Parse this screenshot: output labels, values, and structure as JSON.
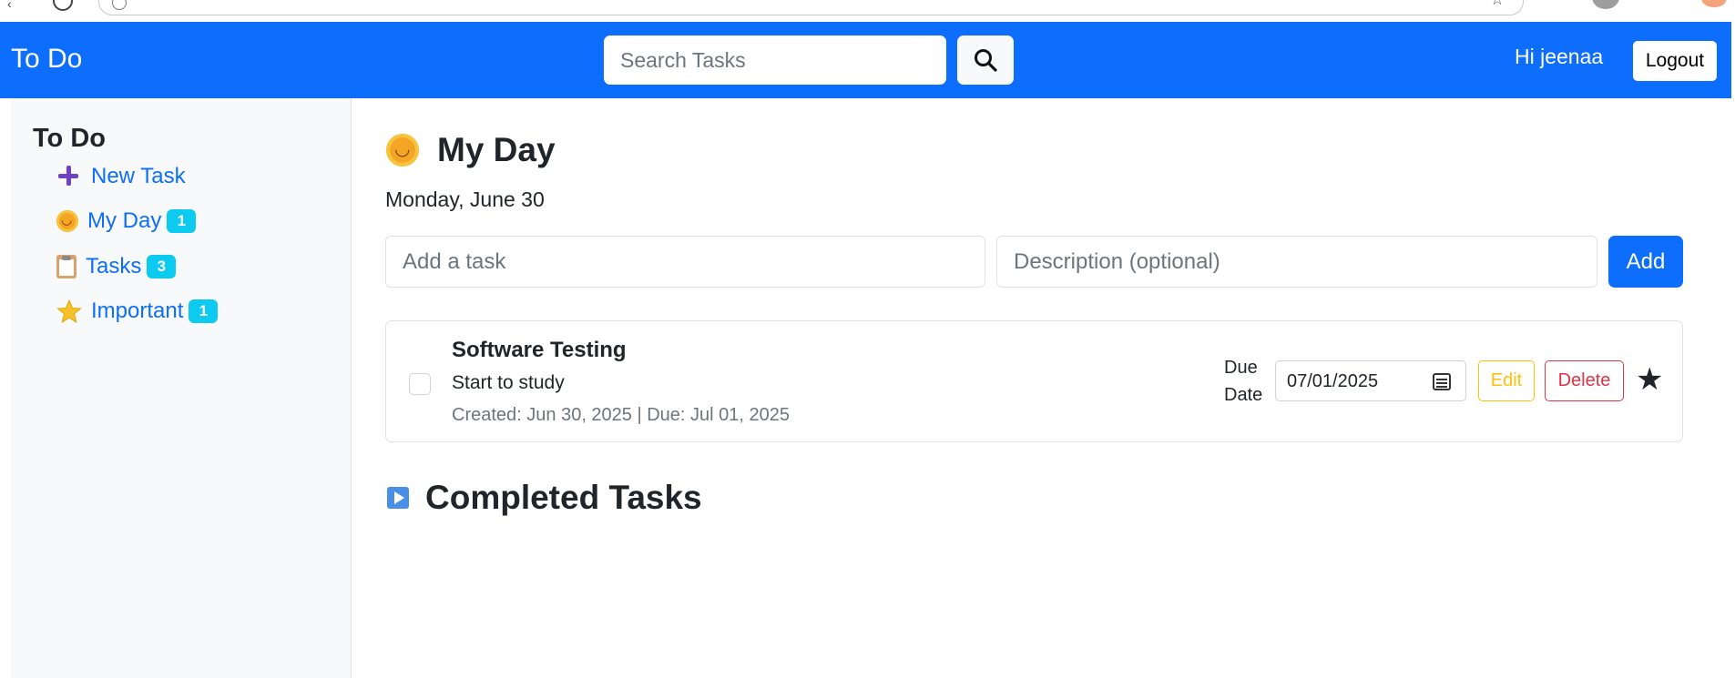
{
  "navbar": {
    "brand": "To Do",
    "search_placeholder": "Search Tasks",
    "greeting": "Hi jeenaa",
    "logout_label": "Logout"
  },
  "sidebar": {
    "title": "To Do",
    "items": [
      {
        "label": "New Task",
        "icon": "plus-icon"
      },
      {
        "label": "My Day",
        "icon": "sun-icon",
        "count": "1"
      },
      {
        "label": "Tasks",
        "icon": "clipboard-icon",
        "count": "3"
      },
      {
        "label": "Important",
        "icon": "star-icon",
        "count": "1"
      }
    ]
  },
  "main": {
    "title": "My Day",
    "date": "Monday, June 30",
    "task_placeholder": "Add a task",
    "description_placeholder": "Description (optional)",
    "add_label": "Add",
    "tasks": [
      {
        "title": "Software Testing",
        "description": "Start to study",
        "meta": "Created: Jun 30, 2025 | Due: Jul 01, 2025",
        "due_label": "Due Date",
        "due_value": "07/01/2025",
        "edit_label": "Edit",
        "delete_label": "Delete",
        "star": "★"
      }
    ],
    "completed_title": "Completed Tasks"
  },
  "colors": {
    "primary": "#0d6efd",
    "badge": "#0dcaf0",
    "warning": "#ffc107",
    "danger": "#dc3545",
    "sidebar_bg": "#f8f9fa"
  }
}
